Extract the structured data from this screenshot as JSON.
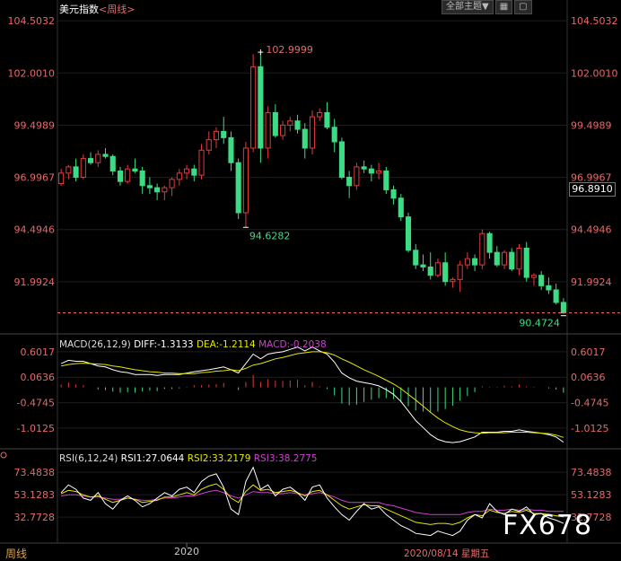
{
  "header": {
    "symbol": "美元指数",
    "period_tag": "<周线>",
    "toolbar": {
      "scope_btn": "全部主题▼",
      "grid_btn": "▦",
      "scroll_btn": "▢"
    }
  },
  "colors": {
    "up": "#e23b3b",
    "down": "#3ddc84",
    "grid": "#1e1e1e",
    "dif": "#ffffff",
    "dea": "#e6e600",
    "macd": "#d040d0",
    "rsi1": "#ffffff",
    "rsi2": "#e6e600",
    "rsi3": "#d040d0"
  },
  "price_panel": {
    "y_labels": [
      "104.5032",
      "102.0010",
      "99.4989",
      "96.9967",
      "94.4946",
      "91.9924"
    ],
    "last_price": "96.8910",
    "high_marker": "102.9999",
    "low_marker_1": "94.6282",
    "low_marker_2": "90.4724"
  },
  "macd_panel": {
    "label": "MACD(26,12,9)",
    "dif": "DIFF:-1.3133",
    "dea": "DEA:-1.2114",
    "macd": "MACD:-0.2038",
    "y_labels": [
      "0.6017",
      "0.0636",
      "-0.4745",
      "-1.0125"
    ]
  },
  "rsi_panel": {
    "label": "RSI(6,12,24)",
    "rsi1": "RSI1:27.0644",
    "rsi2": "RSI2:33.2179",
    "rsi3": "RSI3:38.2775",
    "y_labels": [
      "73.4838",
      "53.1283",
      "32.7728"
    ]
  },
  "footer": {
    "period": "周线",
    "year_label": "2020",
    "date_label": "2020/08/14 星期五"
  },
  "watermark": "FX678",
  "chart_data": {
    "type": "candlestick",
    "candles": [
      [
        96.7,
        97.4,
        96.6,
        97.2
      ],
      [
        97.2,
        97.6,
        96.9,
        97.5
      ],
      [
        97.5,
        97.9,
        96.8,
        97.0
      ],
      [
        97.0,
        98.1,
        96.9,
        97.9
      ],
      [
        97.9,
        98.2,
        97.6,
        97.7
      ],
      [
        97.7,
        98.3,
        97.5,
        98.1
      ],
      [
        98.1,
        98.4,
        97.9,
        98.0
      ],
      [
        98.0,
        98.1,
        97.1,
        97.3
      ],
      [
        97.3,
        97.5,
        96.6,
        96.8
      ],
      [
        96.8,
        97.6,
        96.7,
        97.4
      ],
      [
        97.4,
        97.9,
        97.2,
        97.3
      ],
      [
        97.3,
        97.5,
        96.2,
        96.6
      ],
      [
        96.6,
        97.0,
        96.2,
        96.5
      ],
      [
        96.5,
        96.7,
        95.9,
        96.3
      ],
      [
        96.3,
        96.6,
        95.9,
        96.5
      ],
      [
        96.5,
        97.0,
        96.1,
        96.9
      ],
      [
        96.9,
        97.4,
        96.6,
        97.2
      ],
      [
        97.2,
        97.6,
        96.9,
        97.4
      ],
      [
        97.4,
        97.6,
        96.8,
        97.1
      ],
      [
        97.1,
        98.6,
        96.9,
        98.3
      ],
      [
        98.3,
        99.2,
        98.1,
        98.8
      ],
      [
        98.8,
        99.4,
        98.4,
        99.2
      ],
      [
        99.2,
        99.9,
        98.6,
        98.9
      ],
      [
        98.9,
        99.2,
        97.3,
        97.7
      ],
      [
        97.7,
        97.9,
        95.0,
        95.3
      ],
      [
        95.3,
        98.7,
        94.6,
        98.4
      ],
      [
        98.4,
        102.9,
        98.2,
        102.3
      ],
      [
        102.3,
        103.0,
        97.7,
        98.4
      ],
      [
        98.4,
        100.4,
        97.9,
        100.1
      ],
      [
        100.1,
        100.5,
        98.9,
        99.0
      ],
      [
        99.0,
        99.7,
        98.8,
        99.5
      ],
      [
        99.5,
        99.9,
        99.2,
        99.7
      ],
      [
        99.7,
        100.0,
        99.1,
        99.3
      ],
      [
        99.3,
        99.6,
        97.9,
        98.4
      ],
      [
        98.4,
        100.2,
        98.1,
        99.9
      ],
      [
        99.9,
        100.3,
        99.7,
        100.1
      ],
      [
        100.1,
        100.6,
        99.3,
        99.4
      ],
      [
        99.4,
        99.8,
        98.2,
        98.7
      ],
      [
        98.7,
        98.9,
        96.9,
        97.0
      ],
      [
        97.0,
        97.3,
        96.0,
        96.6
      ],
      [
        96.6,
        97.7,
        96.4,
        97.5
      ],
      [
        97.5,
        97.8,
        97.2,
        97.4
      ],
      [
        97.4,
        97.6,
        96.8,
        97.2
      ],
      [
        97.2,
        97.7,
        96.9,
        97.3
      ],
      [
        97.3,
        97.5,
        96.2,
        96.4
      ],
      [
        96.4,
        96.6,
        95.7,
        96.0
      ],
      [
        96.0,
        96.2,
        94.9,
        95.1
      ],
      [
        95.1,
        95.3,
        93.4,
        93.5
      ],
      [
        93.5,
        93.8,
        92.6,
        92.8
      ],
      [
        92.8,
        93.3,
        92.5,
        92.7
      ],
      [
        92.7,
        93.4,
        92.1,
        92.3
      ],
      [
        92.3,
        93.1,
        92.2,
        92.9
      ],
      [
        92.9,
        93.4,
        91.8,
        92.0
      ],
      [
        92.0,
        92.2,
        91.7,
        92.1
      ],
      [
        92.1,
        93.0,
        91.5,
        92.8
      ],
      [
        92.8,
        93.4,
        92.6,
        93.1
      ],
      [
        93.1,
        93.3,
        92.5,
        92.8
      ],
      [
        92.8,
        94.5,
        92.6,
        94.3
      ],
      [
        94.3,
        94.4,
        93.1,
        93.4
      ],
      [
        93.4,
        93.7,
        92.7,
        92.8
      ],
      [
        92.8,
        93.5,
        92.6,
        93.4
      ],
      [
        93.4,
        93.6,
        92.5,
        92.6
      ],
      [
        92.6,
        93.8,
        92.3,
        93.6
      ],
      [
        93.6,
        93.9,
        92.0,
        92.2
      ],
      [
        92.2,
        92.4,
        91.8,
        92.3
      ],
      [
        92.3,
        92.5,
        91.6,
        91.8
      ],
      [
        91.8,
        92.2,
        91.4,
        91.6
      ],
      [
        91.6,
        91.9,
        90.9,
        91.0
      ],
      [
        91.0,
        91.2,
        90.45,
        90.5
      ]
    ],
    "macd": {
      "dif": [
        0.35,
        0.42,
        0.4,
        0.4,
        0.35,
        0.3,
        0.28,
        0.22,
        0.18,
        0.16,
        0.12,
        0.12,
        0.12,
        0.1,
        0.12,
        0.12,
        0.12,
        0.15,
        0.18,
        0.2,
        0.22,
        0.25,
        0.28,
        0.22,
        0.15,
        0.35,
        0.55,
        0.45,
        0.55,
        0.58,
        0.6,
        0.65,
        0.7,
        0.62,
        0.7,
        0.62,
        0.55,
        0.38,
        0.15,
        0.05,
        -0.02,
        -0.05,
        -0.08,
        -0.12,
        -0.2,
        -0.3,
        -0.45,
        -0.65,
        -0.85,
        -1.0,
        -1.15,
        -1.25,
        -1.3,
        -1.32,
        -1.3,
        -1.25,
        -1.2,
        -1.1,
        -1.1,
        -1.1,
        -1.08,
        -1.08,
        -1.05,
        -1.08,
        -1.1,
        -1.12,
        -1.15,
        -1.2,
        -1.31
      ],
      "dea": [
        0.3,
        0.33,
        0.35,
        0.36,
        0.35,
        0.34,
        0.33,
        0.3,
        0.28,
        0.25,
        0.22,
        0.2,
        0.18,
        0.17,
        0.15,
        0.15,
        0.14,
        0.14,
        0.14,
        0.16,
        0.17,
        0.19,
        0.2,
        0.22,
        0.2,
        0.25,
        0.32,
        0.35,
        0.4,
        0.45,
        0.48,
        0.52,
        0.56,
        0.58,
        0.6,
        0.6,
        0.58,
        0.53,
        0.45,
        0.38,
        0.3,
        0.22,
        0.15,
        0.08,
        0.0,
        -0.08,
        -0.18,
        -0.3,
        -0.42,
        -0.55,
        -0.68,
        -0.8,
        -0.9,
        -0.98,
        -1.05,
        -1.09,
        -1.11,
        -1.12,
        -1.11,
        -1.11,
        -1.11,
        -1.1,
        -1.1,
        -1.1,
        -1.11,
        -1.12,
        -1.13,
        -1.16,
        -1.21
      ],
      "hist": [
        0.05,
        0.09,
        0.05,
        0.04,
        0.0,
        -0.04,
        -0.05,
        -0.08,
        -0.1,
        -0.09,
        -0.1,
        -0.08,
        -0.06,
        -0.07,
        -0.03,
        -0.03,
        -0.02,
        0.01,
        0.04,
        0.04,
        0.05,
        0.06,
        0.08,
        0.0,
        -0.05,
        0.1,
        0.23,
        0.1,
        0.15,
        0.13,
        0.12,
        0.13,
        0.14,
        0.04,
        0.1,
        0.02,
        -0.03,
        -0.15,
        -0.3,
        -0.33,
        -0.32,
        -0.27,
        -0.23,
        -0.2,
        -0.2,
        -0.22,
        -0.27,
        -0.35,
        -0.43,
        -0.45,
        -0.47,
        -0.45,
        -0.4,
        -0.34,
        -0.25,
        -0.16,
        -0.09,
        0.02,
        0.01,
        0.01,
        0.03,
        0.02,
        0.05,
        0.02,
        0.01,
        0.0,
        -0.02,
        -0.04,
        -0.1
      ]
    },
    "rsi": {
      "rsi1": [
        55,
        62,
        58,
        50,
        48,
        55,
        45,
        40,
        48,
        52,
        48,
        42,
        45,
        50,
        55,
        52,
        58,
        60,
        55,
        65,
        70,
        72,
        60,
        40,
        35,
        65,
        78,
        58,
        62,
        52,
        58,
        60,
        55,
        48,
        60,
        62,
        50,
        42,
        35,
        30,
        38,
        45,
        40,
        42,
        35,
        30,
        25,
        22,
        18,
        17,
        16,
        20,
        18,
        16,
        20,
        30,
        35,
        32,
        45,
        38,
        35,
        40,
        38,
        42,
        35,
        36,
        32,
        30,
        27
      ],
      "rsi2": [
        54,
        57,
        56,
        53,
        51,
        52,
        49,
        46,
        48,
        50,
        49,
        46,
        47,
        48,
        51,
        51,
        53,
        55,
        53,
        58,
        61,
        63,
        58,
        50,
        46,
        56,
        62,
        57,
        58,
        55,
        56,
        57,
        55,
        52,
        56,
        57,
        53,
        48,
        43,
        40,
        42,
        44,
        43,
        43,
        40,
        37,
        34,
        31,
        28,
        27,
        26,
        27,
        27,
        26,
        28,
        32,
        35,
        34,
        39,
        37,
        36,
        38,
        37,
        39,
        36,
        36,
        35,
        34,
        33
      ],
      "rsi3": [
        52,
        53,
        53,
        52,
        51,
        51,
        50,
        49,
        49,
        50,
        49,
        48,
        48,
        49,
        50,
        50,
        51,
        52,
        52,
        54,
        56,
        57,
        55,
        52,
        50,
        53,
        56,
        55,
        55,
        54,
        54,
        55,
        54,
        53,
        54,
        55,
        53,
        51,
        48,
        46,
        46,
        46,
        46,
        46,
        44,
        43,
        41,
        39,
        37,
        36,
        35,
        35,
        35,
        35,
        35,
        37,
        38,
        38,
        40,
        39,
        39,
        40,
        39,
        40,
        39,
        39,
        38,
        38,
        38
      ]
    }
  }
}
